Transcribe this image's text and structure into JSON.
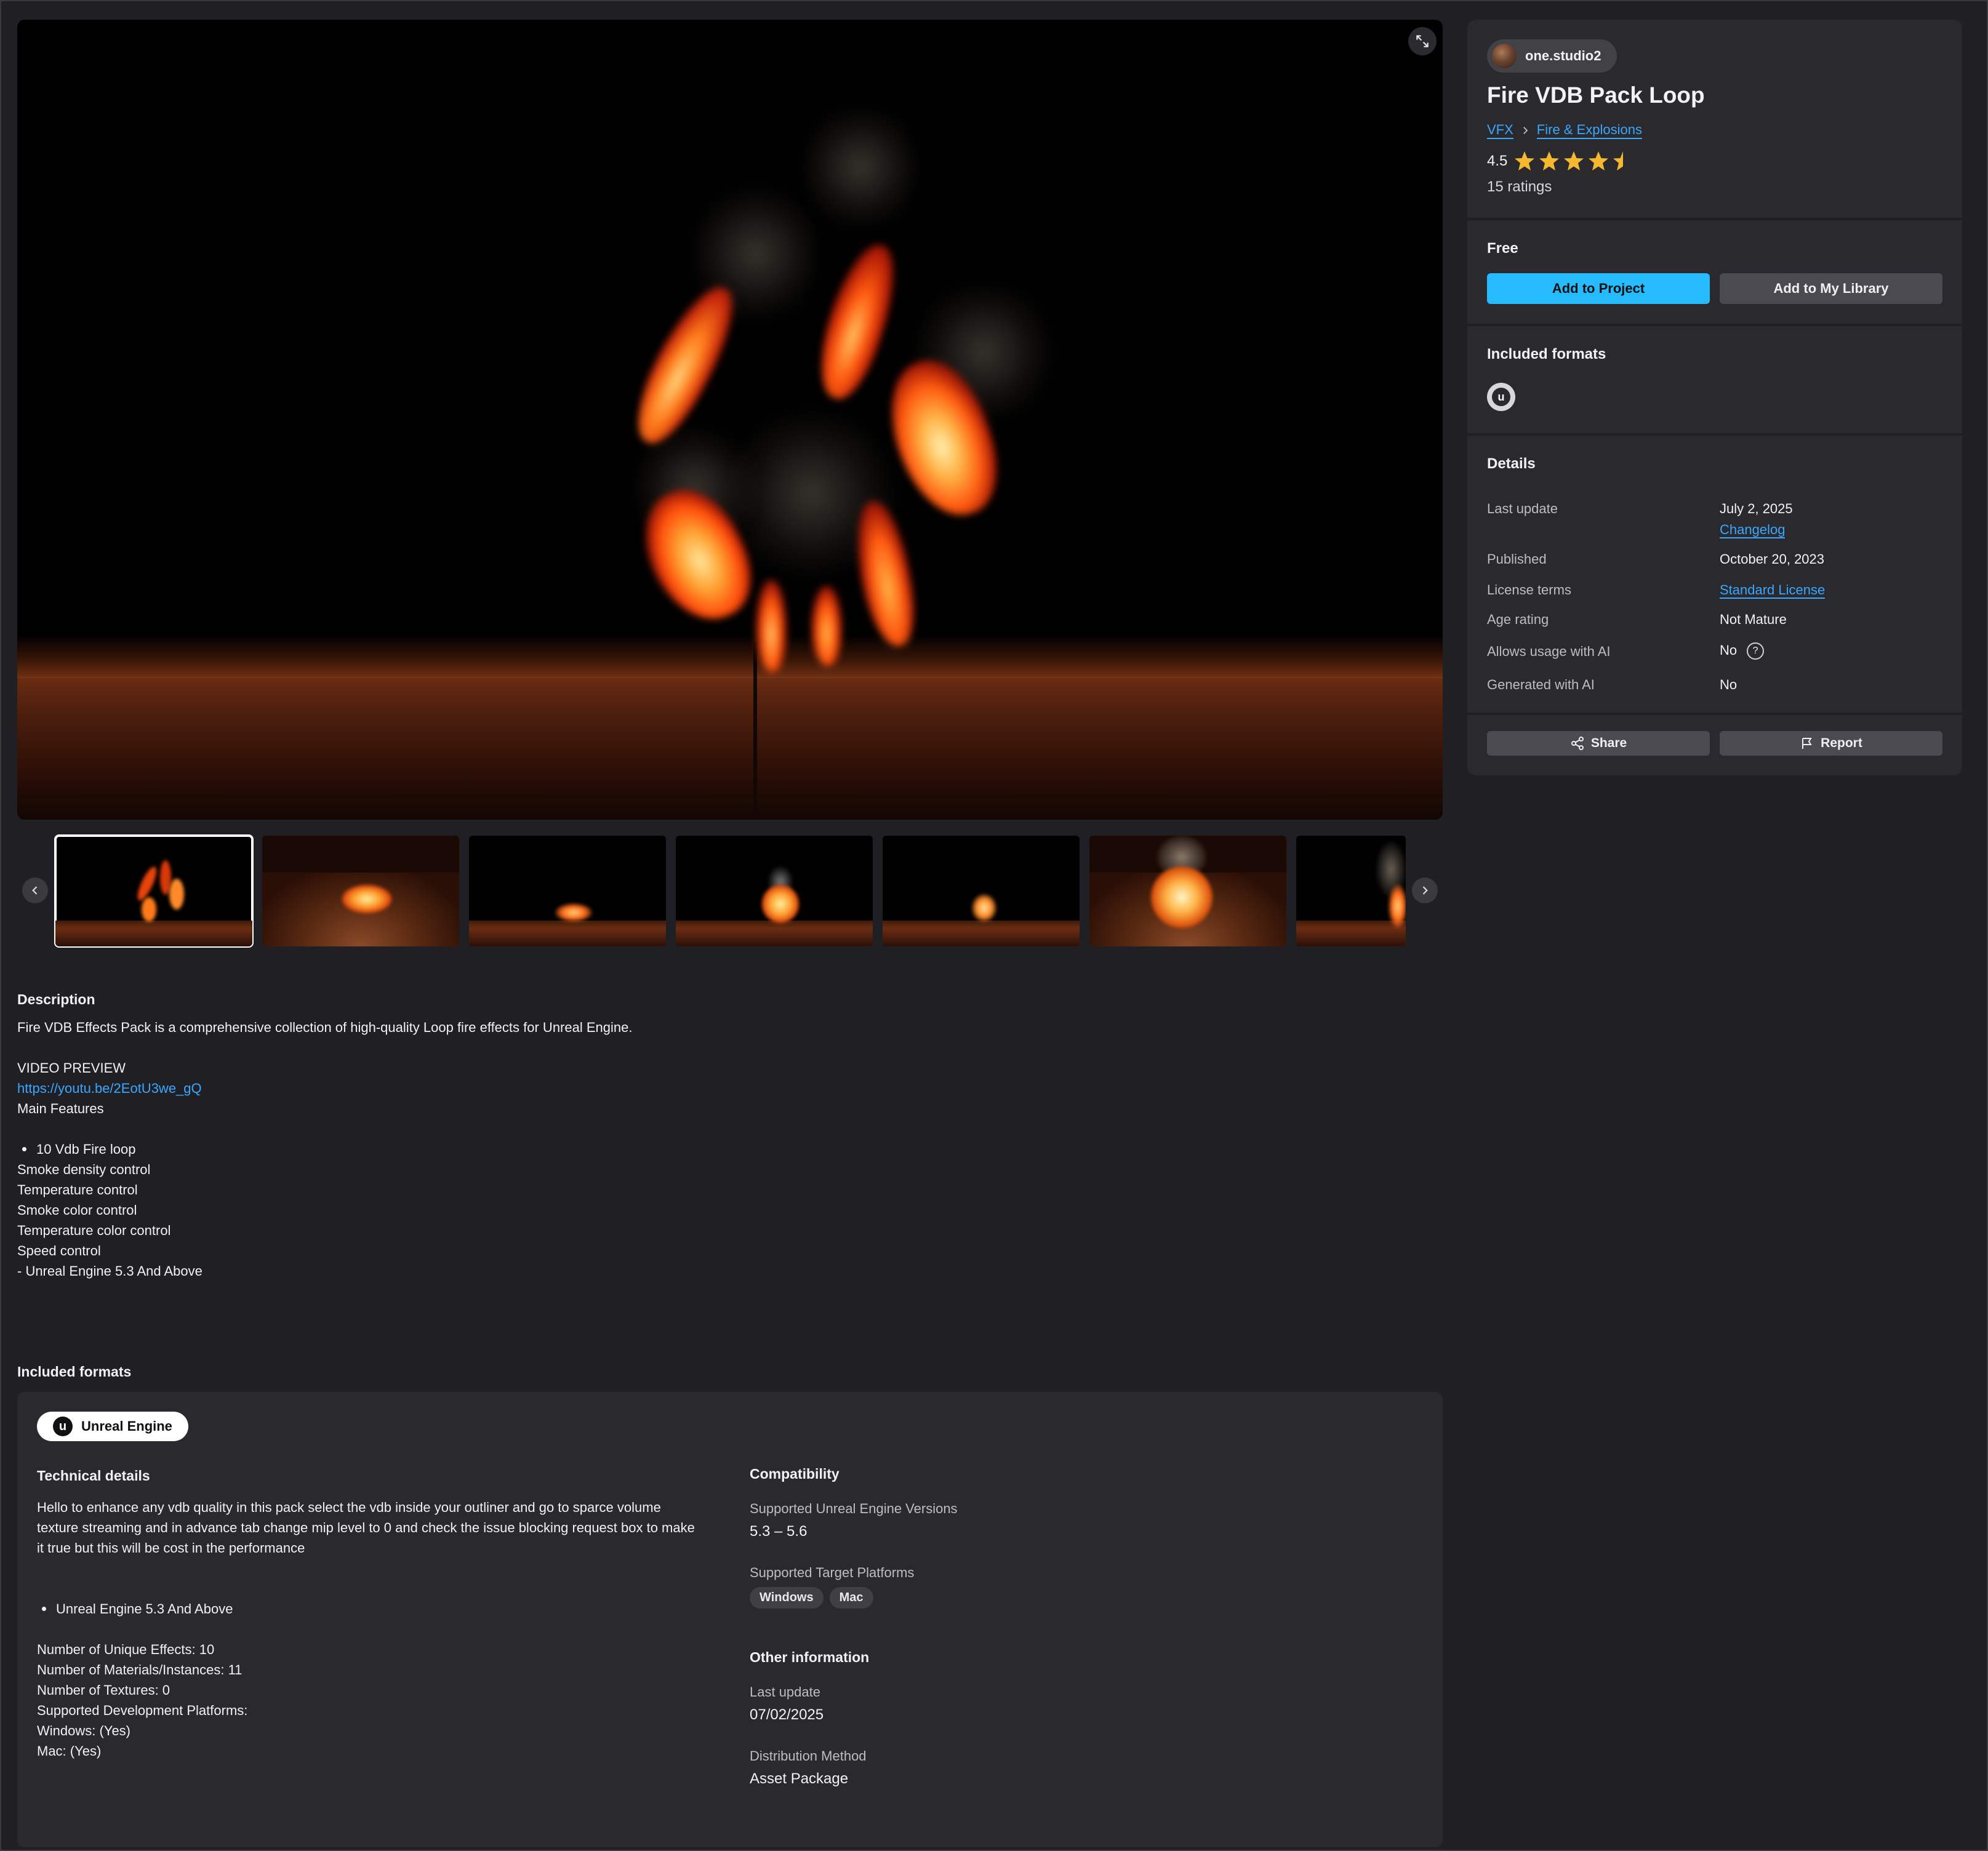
{
  "product": {
    "seller": "one.studio2",
    "title": "Fire VDB Pack Loop",
    "breadcrumbs": [
      "VFX",
      "Fire & Explosions"
    ],
    "rating": "4.5",
    "rating_value": 4.5,
    "rating_max": 5,
    "ratings_count": "15 ratings"
  },
  "purchase": {
    "price": "Free",
    "add_to_project": "Add to Project",
    "add_to_library": "Add to My Library"
  },
  "included_formats_sidebar": {
    "title": "Included formats",
    "icon": "unreal-engine-icon"
  },
  "details": {
    "title": "Details",
    "last_update_label": "Last update",
    "last_update_value": "July 2, 2025",
    "changelog": "Changelog",
    "published_label": "Published",
    "published_value": "October 20, 2023",
    "license_label": "License terms",
    "license_value": "Standard License",
    "age_label": "Age rating",
    "age_value": "Not Mature",
    "ai_usage_label": "Allows usage with AI",
    "ai_usage_value": "No",
    "generated_ai_label": "Generated with AI",
    "generated_ai_value": "No"
  },
  "actions": {
    "share": "Share",
    "report": "Report"
  },
  "gallery": {
    "thumbnail_count": 7,
    "active_index": 0
  },
  "description": {
    "title": "Description",
    "intro": "Fire VDB Effects Pack is a comprehensive collection of high-quality Loop fire effects for Unreal Engine.",
    "video_label": "VIDEO PREVIEW",
    "video_link": "https://youtu.be/2EotU3we_gQ",
    "features_title": "Main Features",
    "bullet": "10 Vdb Fire loop",
    "features": [
      "Smoke density control",
      "Temperature control",
      "Smoke color control",
      "Temperature color control",
      "Speed control",
      "- Unreal Engine 5.3 And Above"
    ]
  },
  "included_formats": {
    "title": "Included formats",
    "engine": "Unreal Engine",
    "technical": {
      "title": "Technical details",
      "text": "Hello to enhance any vdb quality in this pack select the vdb inside your outliner and go to sparce volume texture streaming and in advance tab change mip level to 0 and check the issue blocking request box to make it true but this will be cost in the performance",
      "bullet": "Unreal Engine 5.3 And Above",
      "lines": [
        "Number of Unique Effects: 10",
        "Number of Materials/Instances: 11",
        "Number of Textures: 0",
        "Supported Development Platforms:",
        "Windows: (Yes)",
        "Mac: (Yes)"
      ]
    },
    "compatibility": {
      "title": "Compatibility",
      "versions_label": "Supported Unreal Engine Versions",
      "versions_value": "5.3 – 5.6",
      "platforms_label": "Supported Target Platforms",
      "platforms": [
        "Windows",
        "Mac"
      ]
    },
    "other": {
      "title": "Other information",
      "last_update_label": "Last update",
      "last_update_value": "07/02/2025",
      "distribution_label": "Distribution Method",
      "distribution_value": "Asset Package"
    }
  },
  "colors": {
    "accent": "#26bbff",
    "link": "#3aa7ff",
    "background": "#202024",
    "card": "#2a2a2e",
    "star": "#f5b82e"
  }
}
